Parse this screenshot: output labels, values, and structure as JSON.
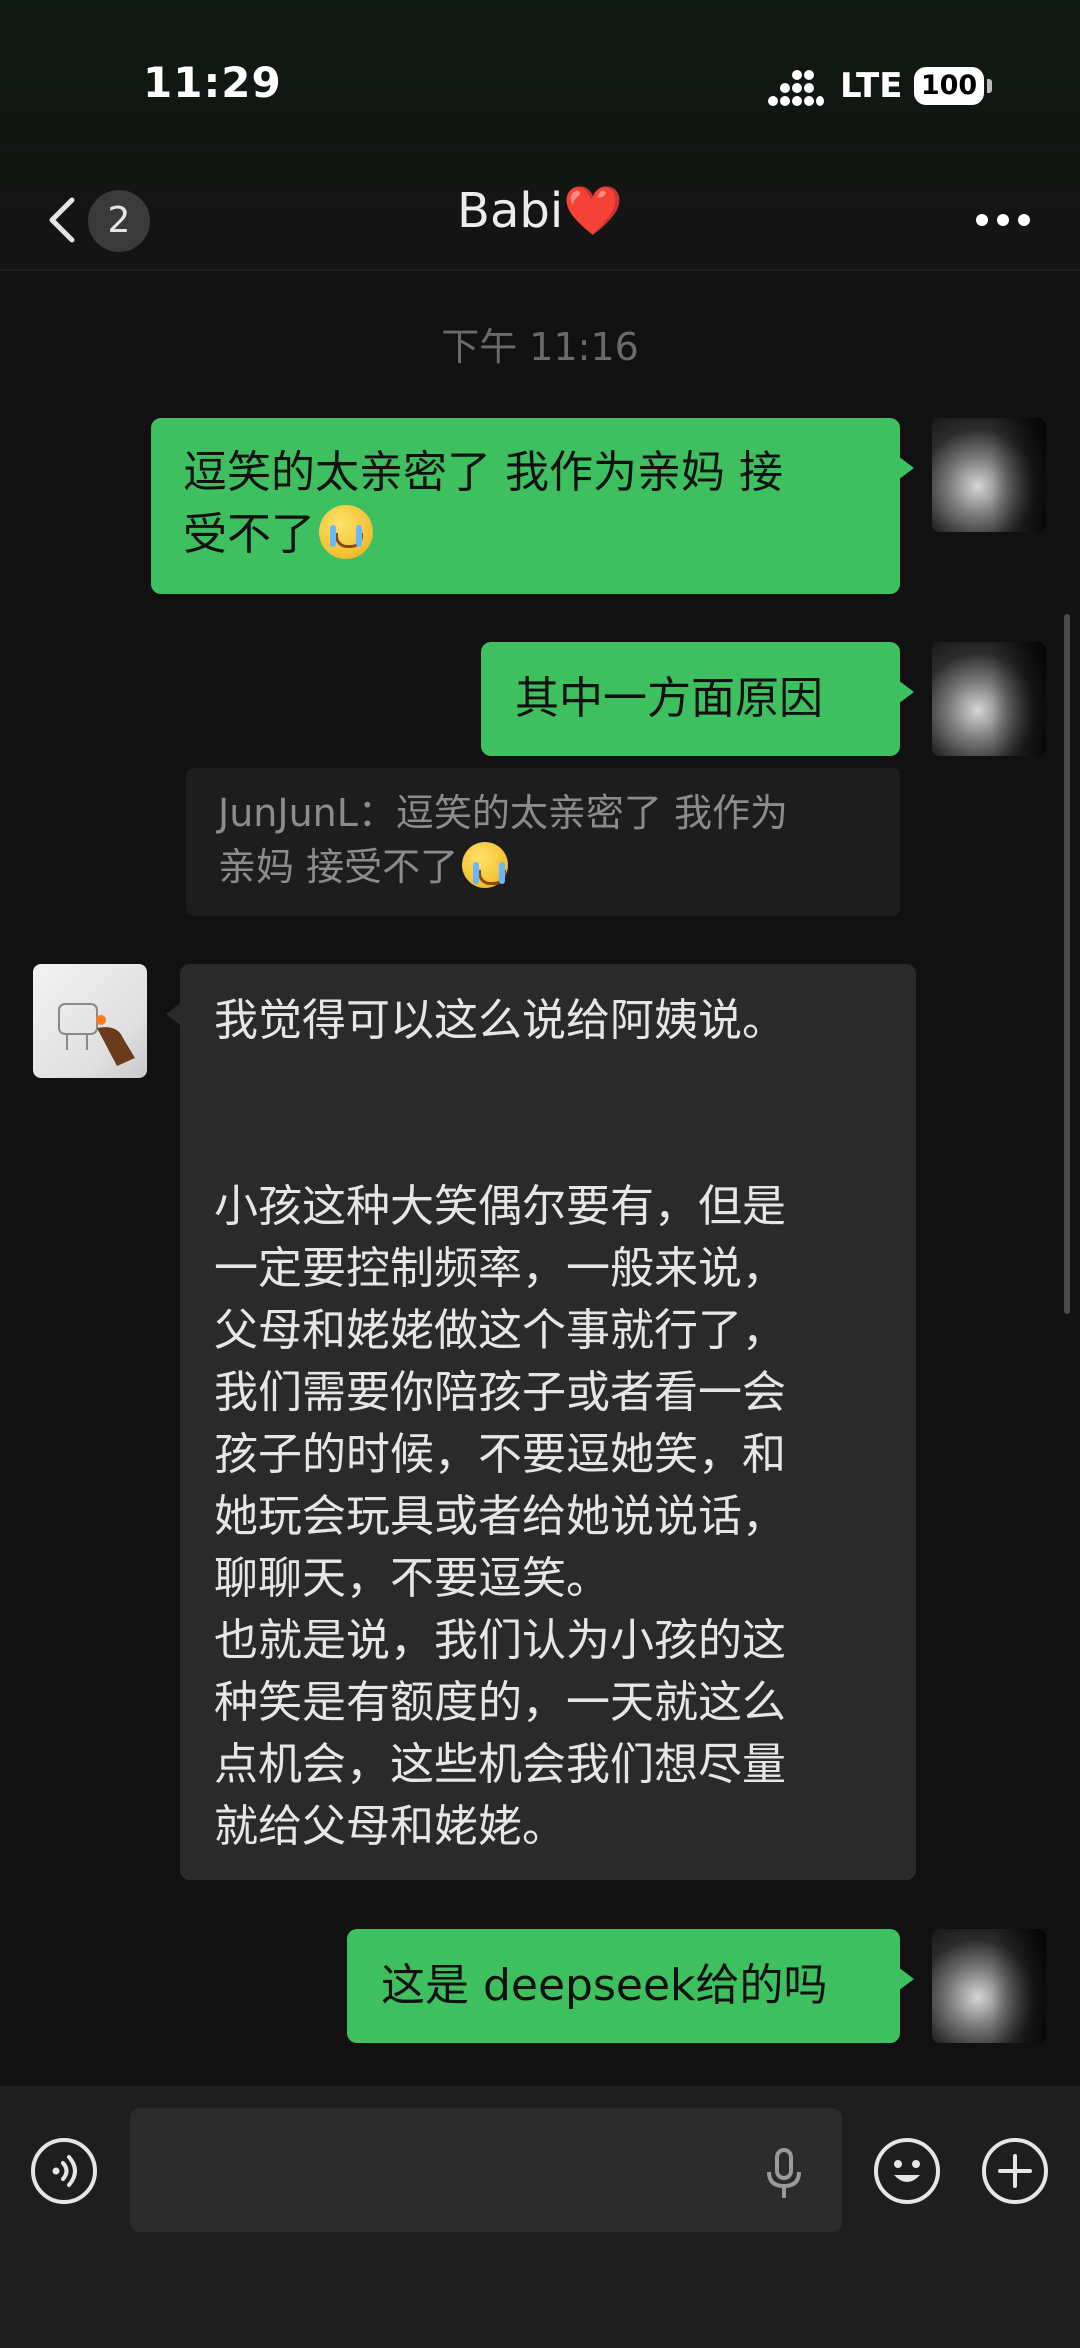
{
  "status_bar": {
    "time": "11:29",
    "network": "LTE",
    "battery": "100"
  },
  "nav": {
    "back_icon": "chevron-left-icon",
    "unread_count": "2",
    "title": "Babi❤️",
    "more_icon": "more-horizontal-icon"
  },
  "chat": {
    "timestamp": "下午 11:16",
    "messages": [
      {
        "side": "right",
        "text": "逗笑的太亲密了 我作为亲妈 接\n受不了",
        "emoji": "crying-face-emoji"
      },
      {
        "side": "right",
        "text": "其中一方面原因"
      },
      {
        "quote": "JunJunL：逗笑的太亲密了 我作为\n亲妈 接受不了"
      },
      {
        "side": "left",
        "text": "我觉得可以这么说给阿姨说。\n\n\n小孩这种大笑偶尔要有，但是\n一定要控制频率，一般来说，\n父母和姥姥做这个事就行了，\n我们需要你陪孩子或者看一会\n孩子的时候，不要逗她笑，和\n她玩会玩具或者给她说说话，\n聊聊天，不要逗笑。\n也就是说，我们认为小孩的这\n种笑是有额度的，一天就这么\n点机会，这些机会我们想尽量\n就给父母和姥姥。"
      },
      {
        "side": "right",
        "text": "这是 deepseek给的吗"
      }
    ]
  },
  "input_bar": {
    "voice_icon": "voice-mode-icon",
    "mic_icon": "microphone-icon",
    "emoji_icon": "smiley-icon",
    "plus_icon": "plus-icon"
  },
  "colors": {
    "self_bubble": "#3ebf60",
    "peer_bubble": "#2a2a2a",
    "background": "#111111"
  }
}
